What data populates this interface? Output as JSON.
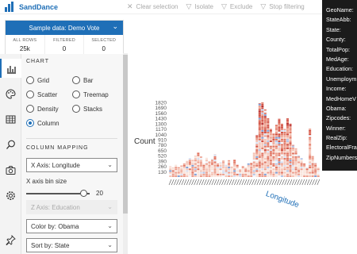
{
  "app": {
    "name": "SandDance"
  },
  "toolbar": {
    "items": [
      {
        "label": "Clear selection",
        "icon": "close-icon"
      },
      {
        "label": "Isolate",
        "icon": "filter-icon"
      },
      {
        "label": "Exclude",
        "icon": "filter-exclude-icon"
      },
      {
        "label": "Stop filtering",
        "icon": "stop-filter-icon"
      }
    ]
  },
  "dataset": {
    "title": "Sample data: Demo Vote",
    "stats": [
      {
        "label": "ALL ROWS",
        "value": "25k"
      },
      {
        "label": "FILTERED",
        "value": "0"
      },
      {
        "label": "SELECTED",
        "value": "0"
      }
    ]
  },
  "chart_section": {
    "title": "CHART",
    "options": [
      "Grid",
      "Bar",
      "Scatter",
      "Treemap",
      "Density",
      "Stacks",
      "Column"
    ],
    "selected": "Column"
  },
  "mapping": {
    "title": "COLUMN MAPPING",
    "x_axis": "X Axis: Longitude",
    "bin_label": "X axis bin size",
    "bin_value": "20",
    "bin_fraction": 0.9,
    "z_axis": "Z Axis: Education",
    "color_by": "Color by: Obama",
    "sort_by": "Sort by: State"
  },
  "tooltip": {
    "rows": [
      "GeoName:",
      "StateAbb:",
      "State:",
      "County:",
      "TotalPop:",
      "MedAge:",
      "Education:",
      "Unemploym",
      "Income:",
      "MedHomeV",
      "Obama:",
      "Zipcodes:",
      "Winner:",
      "RealZip:",
      "ElectoralFra",
      "ZipNumbers"
    ]
  },
  "chart_data": {
    "type": "bar",
    "ylabel": "Count",
    "xlabel": "Longitude",
    "y_ticks": [
      "1820",
      "1690",
      "1560",
      "1430",
      "1300",
      "1170",
      "1040",
      "910",
      "780",
      "650",
      "520",
      "390",
      "260",
      "130"
    ],
    "values": [
      260,
      230,
      300,
      240,
      280,
      330,
      390,
      460,
      420,
      520,
      600,
      500,
      320,
      470,
      380,
      440,
      560,
      330,
      360,
      400,
      300,
      410,
      260,
      420,
      310,
      190,
      270,
      240,
      330,
      350,
      600,
      1040,
      1800,
      1820,
      1650,
      1430,
      1170,
      1060,
      1300,
      1420,
      1300,
      1170,
      1430,
      1300,
      780,
      700,
      520,
      460,
      330,
      230,
      1180,
      520,
      360,
      240
    ],
    "x_tick_count": 60,
    "colors": {
      "red": "#c0392b",
      "white": "#f6e6e0",
      "blue": "#3a6fb0"
    }
  },
  "colors": {
    "accent": "#1f6fb7"
  }
}
